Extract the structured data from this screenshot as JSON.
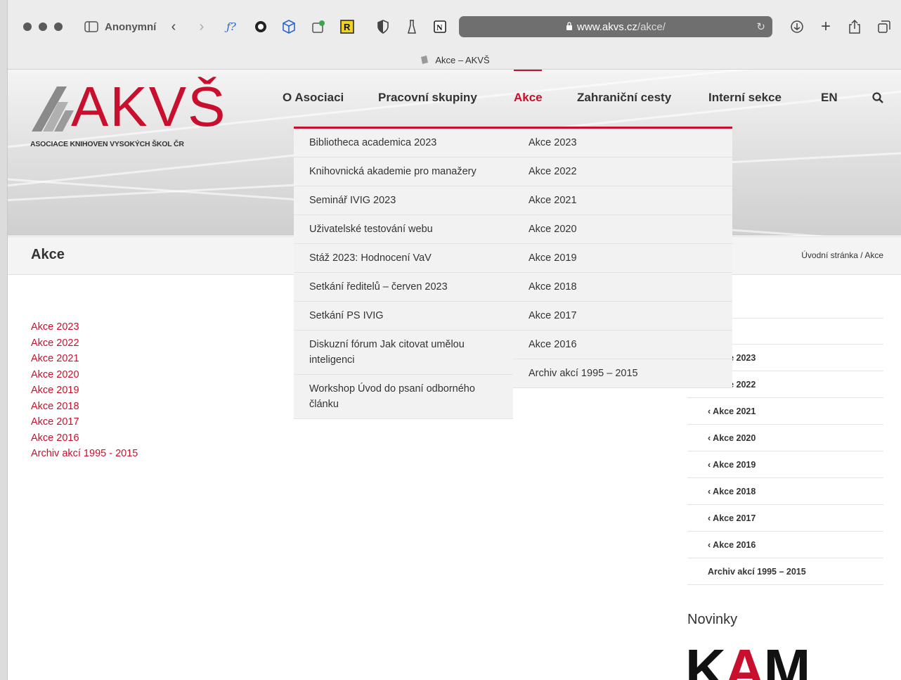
{
  "browser": {
    "profile_label": "Anonymní",
    "address_host": "www.akvs.cz",
    "address_path": "/akce/",
    "tab_title": "Akce – AKVŠ"
  },
  "site": {
    "logo_text": "AKVŠ",
    "logo_subtitle": "ASOCIACE KNIHOVEN VYSOKÝCH ŠKOL ČR",
    "nav": [
      "O Asociaci",
      "Pracovní skupiny",
      "Akce",
      "Zahraniční cesty",
      "Interní sekce",
      "EN"
    ],
    "active_nav": "Akce"
  },
  "dropdown": {
    "left": [
      "Bibliotheca academica 2023",
      "Knihovnická akademie pro manažery",
      "Seminář IVIG 2023",
      "Uživatelské testování webu",
      "Stáž 2023: Hodnocení VaV",
      "Setkání ředitelů – červen 2023",
      "Setkání PS IVIG",
      "Diskuzní fórum Jak citovat umělou inteligenci",
      "Workshop Úvod do psaní odborného článku"
    ],
    "right": [
      "Akce 2023",
      "Akce 2022",
      "Akce 2021",
      "Akce 2020",
      "Akce 2019",
      "Akce 2018",
      "Akce 2017",
      "Akce 2016",
      "Archiv akcí 1995 – 2015"
    ]
  },
  "page": {
    "title": "Akce",
    "breadcrumb": "Úvodní stránka / Akce",
    "links": [
      "Akce 2023",
      "Akce 2022",
      "Akce 2021",
      "Akce 2020",
      "Akce 2019",
      "Akce 2018",
      "Akce 2017",
      "Akce 2016",
      "Archiv akcí 1995 - 2015"
    ]
  },
  "sidebar": {
    "items": [
      "‹ Akce 2023",
      "‹ Akce 2022",
      "‹ Akce 2021",
      "‹ Akce 2020",
      "‹ Akce 2019",
      "‹ Akce 2018",
      "‹ Akce 2017",
      "‹ Akce 2016",
      "Archiv akcí 1995 – 2015"
    ],
    "news_heading": "Novinky",
    "news_logo_text": "KAM"
  },
  "colors": {
    "accent": "#c8102e"
  }
}
